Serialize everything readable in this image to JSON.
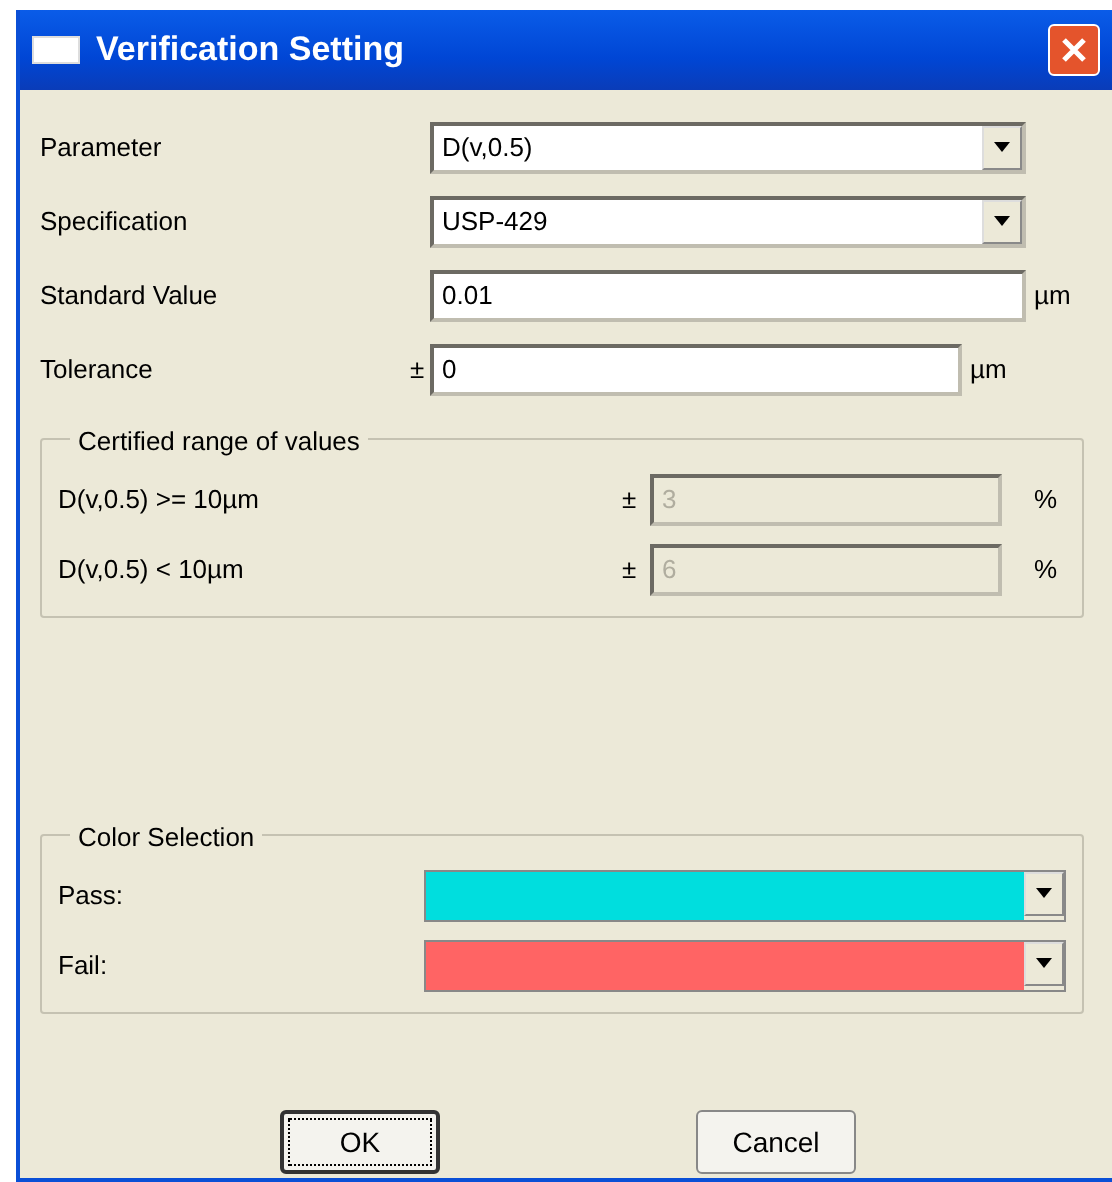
{
  "window": {
    "title": "Verification Setting"
  },
  "fields": [
    {
      "kind": "combo",
      "label": "Parameter",
      "value": "D(v,0.5)"
    },
    {
      "kind": "combo",
      "label": "Specification",
      "value": "USP-429"
    },
    {
      "kind": "text",
      "label": "Standard Value",
      "value": "0.01",
      "unit": "µm"
    },
    {
      "kind": "text",
      "label": "Tolerance",
      "prefix": "±",
      "value": "0",
      "unit": "µm"
    }
  ],
  "certified_range": {
    "title": "Certified range of values",
    "rows": [
      {
        "label": "D(v,0.5) >= 10µm",
        "prefix": "±",
        "value": "3",
        "unit": "%",
        "disabled": true
      },
      {
        "label": "D(v,0.5) < 10µm",
        "prefix": "±",
        "value": "6",
        "unit": "%",
        "disabled": true
      }
    ]
  },
  "color_selection": {
    "title": "Color Selection",
    "rows": [
      {
        "label": "Pass:",
        "color": "#00dede"
      },
      {
        "label": "Fail:",
        "color": "#ff6464"
      }
    ]
  },
  "buttons": [
    {
      "label": "OK",
      "focused": true
    },
    {
      "label": "Cancel",
      "focused": false
    }
  ]
}
